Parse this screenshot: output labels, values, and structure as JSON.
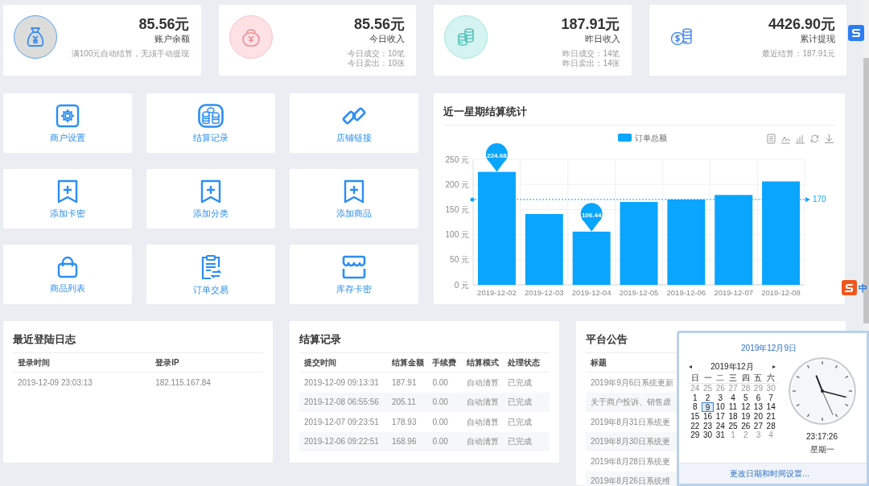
{
  "stats": [
    {
      "kind": "balance",
      "value": "85.56元",
      "label": "账户余额",
      "notes": [
        "满100元自动结算，无须手动提现"
      ]
    },
    {
      "kind": "today",
      "value": "85.56元",
      "label": "今日收入",
      "notes": [
        "今日成交：10笔",
        "今日卖出：10张"
      ]
    },
    {
      "kind": "yesterday",
      "value": "187.91元",
      "label": "昨日收入",
      "notes": [
        "昨日成交：14笔",
        "昨日卖出：14张"
      ]
    },
    {
      "kind": "withdrawn",
      "value": "4426.90元",
      "label": "累计提现",
      "notes": [
        "最近结算：187.91元"
      ]
    }
  ],
  "shortcuts": [
    {
      "kind": "gear",
      "label": "商户设置"
    },
    {
      "kind": "coins",
      "label": "结算记录"
    },
    {
      "kind": "link",
      "label": "店铺链接"
    },
    {
      "kind": "bookmark-plus",
      "label": "添加卡密"
    },
    {
      "kind": "bookmark-plus",
      "label": "添加分类"
    },
    {
      "kind": "bookmark-plus",
      "label": "添加商品"
    },
    {
      "kind": "bag",
      "label": "商品列表"
    },
    {
      "kind": "clipboard",
      "label": "订单交易"
    },
    {
      "kind": "store",
      "label": "库存卡密"
    }
  ],
  "chart": {
    "title": "近一星期结算统计",
    "chart_data": {
      "type": "bar",
      "categories": [
        "2019-12-02",
        "2019-12-03",
        "2019-12-04",
        "2019-12-05",
        "2019-12-06",
        "2019-12-07",
        "2019-12-08"
      ],
      "series": [
        {
          "name": "订单总额",
          "color": "#0aa5ff",
          "values": [
            225,
            141,
            106,
            165,
            170,
            179,
            206
          ]
        }
      ],
      "ylim": [
        0,
        250
      ],
      "grid": true,
      "yticks": [
        {
          "value": 0,
          "label": "0 元"
        },
        {
          "value": 50,
          "label": "50 元"
        },
        {
          "value": 100,
          "label": "100 元"
        },
        {
          "value": 150,
          "label": "150 元"
        },
        {
          "value": 200,
          "label": "200 元"
        },
        {
          "value": 250,
          "label": "250 元"
        }
      ],
      "annotations": [
        {
          "x": "2019-12-02",
          "y": 225,
          "text": "224.68"
        },
        {
          "x": "2019-12-04",
          "y": 106,
          "text": "106.44"
        }
      ],
      "ref_lines": [
        {
          "axis": "y",
          "value": 170,
          "label": "170"
        }
      ]
    }
  },
  "login_log": {
    "title": "最近登陆日志",
    "columns": [
      "登录时间",
      "登录IP"
    ],
    "rows": [
      [
        "2019-12-09 23:03:13",
        "182.115.167.84"
      ]
    ]
  },
  "settlements": {
    "title": "结算记录",
    "columns": [
      "提交时间",
      "结算金额",
      "手续费",
      "结算模式",
      "处理状态"
    ],
    "rows": [
      [
        "2019-12-09 09:13:31",
        "187.91",
        "0.00",
        "自动清算",
        "已完成"
      ],
      [
        "2019-12-08 06:55:56",
        "205.11",
        "0.00",
        "自动清算",
        "已完成"
      ],
      [
        "2019-12-07 09:23:51",
        "178.93",
        "0.00",
        "自动清算",
        "已完成"
      ],
      [
        "2019-12-06 09:22:51",
        "168.96",
        "0.00",
        "自动清算",
        "已完成"
      ]
    ]
  },
  "announcements": {
    "title": "平台公告",
    "columns": [
      "标题"
    ],
    "rows": [
      "2019年9月6日系统更新",
      "关于商户投诉、销售虚",
      "2019年8月31日系统更",
      "2019年8月30日系统更",
      "2019年8月28日系统更",
      "2019年8月26日系统维"
    ]
  },
  "calendar_popup": {
    "date_title": "2019年12月9日",
    "month": "2019年12月",
    "prev": "◂",
    "next": "▸",
    "weekdays": [
      "日",
      "一",
      "二",
      "三",
      "四",
      "五",
      "六"
    ],
    "days": [
      {
        "label": "24",
        "muted": true,
        "selected": false
      },
      {
        "label": "25",
        "muted": true,
        "selected": false
      },
      {
        "label": "26",
        "muted": true,
        "selected": false
      },
      {
        "label": "27",
        "muted": true,
        "selected": false
      },
      {
        "label": "28",
        "muted": true,
        "selected": false
      },
      {
        "label": "29",
        "muted": true,
        "selected": false
      },
      {
        "label": "30",
        "muted": true,
        "selected": false
      },
      {
        "label": "1",
        "muted": false,
        "selected": false
      },
      {
        "label": "2",
        "muted": false,
        "selected": false
      },
      {
        "label": "3",
        "muted": false,
        "selected": false
      },
      {
        "label": "4",
        "muted": false,
        "selected": false
      },
      {
        "label": "5",
        "muted": false,
        "selected": false
      },
      {
        "label": "6",
        "muted": false,
        "selected": false
      },
      {
        "label": "7",
        "muted": false,
        "selected": false
      },
      {
        "label": "8",
        "muted": false,
        "selected": false
      },
      {
        "label": "9",
        "muted": false,
        "selected": true
      },
      {
        "label": "10",
        "muted": false,
        "selected": false
      },
      {
        "label": "11",
        "muted": false,
        "selected": false
      },
      {
        "label": "12",
        "muted": false,
        "selected": false
      },
      {
        "label": "13",
        "muted": false,
        "selected": false
      },
      {
        "label": "14",
        "muted": false,
        "selected": false
      },
      {
        "label": "15",
        "muted": false,
        "selected": false
      },
      {
        "label": "16",
        "muted": false,
        "selected": false
      },
      {
        "label": "17",
        "muted": false,
        "selected": false
      },
      {
        "label": "18",
        "muted": false,
        "selected": false
      },
      {
        "label": "19",
        "muted": false,
        "selected": false
      },
      {
        "label": "20",
        "muted": false,
        "selected": false
      },
      {
        "label": "21",
        "muted": false,
        "selected": false
      },
      {
        "label": "22",
        "muted": false,
        "selected": false
      },
      {
        "label": "23",
        "muted": false,
        "selected": false
      },
      {
        "label": "24",
        "muted": false,
        "selected": false
      },
      {
        "label": "25",
        "muted": false,
        "selected": false
      },
      {
        "label": "26",
        "muted": false,
        "selected": false
      },
      {
        "label": "27",
        "muted": false,
        "selected": false
      },
      {
        "label": "28",
        "muted": false,
        "selected": false
      },
      {
        "label": "29",
        "muted": false,
        "selected": false
      },
      {
        "label": "30",
        "muted": false,
        "selected": false
      },
      {
        "label": "31",
        "muted": false,
        "selected": false
      },
      {
        "label": "1",
        "muted": true,
        "selected": false
      },
      {
        "label": "2",
        "muted": true,
        "selected": false
      },
      {
        "label": "3",
        "muted": true,
        "selected": false
      },
      {
        "label": "4",
        "muted": true,
        "selected": false
      }
    ],
    "time": "23:17:26",
    "weekday": "星期一",
    "settings_link": "更改日期和时间设置..."
  },
  "ime": {
    "label": "中"
  }
}
